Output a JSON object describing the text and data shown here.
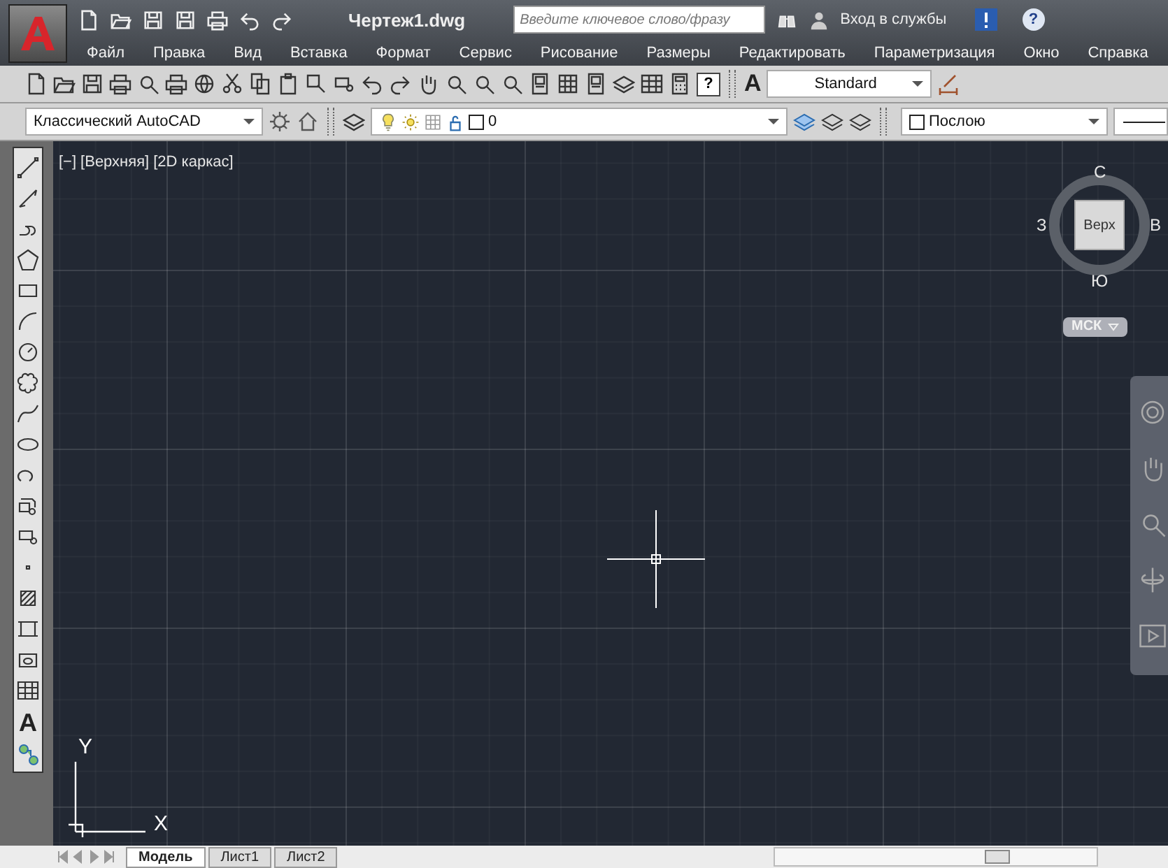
{
  "window": {
    "title": "Чертеж1.dwg"
  },
  "search": {
    "placeholder": "Введите ключевое слово/фразу"
  },
  "sign_in": {
    "label": "Вход в службы"
  },
  "help": {
    "glyph": "?"
  },
  "menu": [
    "Файл",
    "Правка",
    "Вид",
    "Вставка",
    "Формат",
    "Сервис",
    "Рисование",
    "Размеры",
    "Редактировать",
    "Параметризация",
    "Окно",
    "Справка"
  ],
  "standard_toolbar": {
    "help_glyph": "?"
  },
  "text_style": {
    "glyph": "A",
    "value": "Standard"
  },
  "workspace": {
    "value": "Классический AutoCAD"
  },
  "layer": {
    "value": "0"
  },
  "color": {
    "value": "Послою"
  },
  "draw_toolbar": {
    "text_glyph": "A"
  },
  "viewport_controls": [
    "[−]",
    "[Верхняя]",
    "[2D каркас]"
  ],
  "viewcube": {
    "face": "Верх",
    "north": "С",
    "south": "Ю",
    "west": "З",
    "east": "В",
    "ucs": "МСК"
  },
  "ucs_icon": {
    "x": "X",
    "y": "Y"
  },
  "layout_tabs": [
    {
      "label": "Модель",
      "selected": true
    },
    {
      "label": "Лист1",
      "selected": false
    },
    {
      "label": "Лист2",
      "selected": false
    }
  ]
}
